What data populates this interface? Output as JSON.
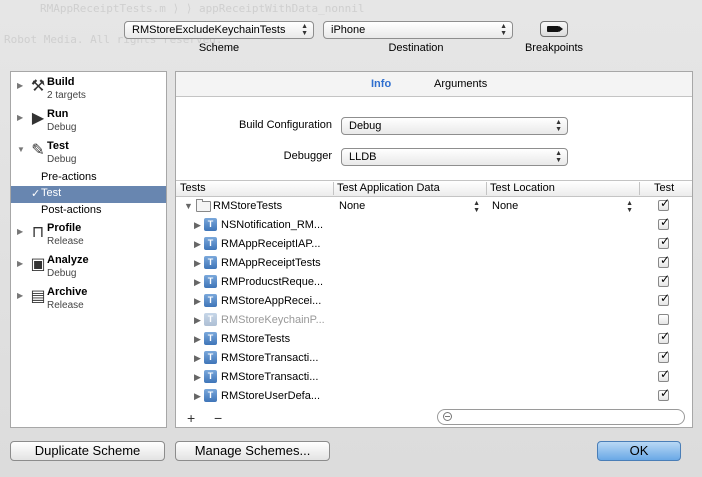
{
  "background": {
    "line1": "RMAppReceiptTests.m  ⟩  ⟩  appReceiptWithData_nonnil",
    "line2": "Robot Media. All rights reserved."
  },
  "toolbar": {
    "scheme_value": "RMStoreExcludeKeychainTests",
    "scheme_label": "Scheme",
    "destination_value": "iPhone",
    "destination_label": "Destination",
    "breakpoints_label": "Breakpoints"
  },
  "actions": [
    {
      "name": "Build",
      "subtitle": "2 targets",
      "icon": "hammer-icon",
      "glyph": "⚒"
    },
    {
      "name": "Run",
      "subtitle": "Debug",
      "icon": "play-icon",
      "glyph": "▶"
    },
    {
      "name": "Test",
      "subtitle": "Debug",
      "icon": "wrench-icon",
      "glyph": "🔧",
      "expanded": true,
      "subitems": [
        "Pre-actions",
        "Test",
        "Post-actions"
      ],
      "selected_subitem": "Test"
    },
    {
      "name": "Profile",
      "subtitle": "Release",
      "icon": "caliper-icon",
      "glyph": "⌖"
    },
    {
      "name": "Analyze",
      "subtitle": "Debug",
      "icon": "analyze-icon",
      "glyph": "▣"
    },
    {
      "name": "Archive",
      "subtitle": "Release",
      "icon": "archive-icon",
      "glyph": "▤"
    }
  ],
  "tabs": [
    "Info",
    "Arguments"
  ],
  "active_tab": "Info",
  "form": {
    "build_config_label": "Build Configuration",
    "build_config_value": "Debug",
    "debugger_label": "Debugger",
    "debugger_value": "LLDB"
  },
  "table": {
    "headers": [
      "Tests",
      "Test Application Data",
      "Test Location",
      "Test"
    ],
    "group": {
      "name": "RMStoreTests",
      "app_data": "None",
      "location": "None",
      "checked": true
    },
    "rows": [
      {
        "name": "NSNotification_RM...",
        "checked": true,
        "enabled": true
      },
      {
        "name": "RMAppReceiptIAP...",
        "checked": true,
        "enabled": true
      },
      {
        "name": "RMAppReceiptTests",
        "checked": true,
        "enabled": true
      },
      {
        "name": "RMProducstReque...",
        "checked": true,
        "enabled": true
      },
      {
        "name": "RMStoreAppRecei...",
        "checked": true,
        "enabled": true
      },
      {
        "name": "RMStoreKeychainP...",
        "checked": false,
        "enabled": false
      },
      {
        "name": "RMStoreTests",
        "checked": true,
        "enabled": true
      },
      {
        "name": "RMStoreTransacti...",
        "checked": true,
        "enabled": true
      },
      {
        "name": "RMStoreTransacti...",
        "checked": true,
        "enabled": true
      },
      {
        "name": "RMStoreUserDefa...",
        "checked": true,
        "enabled": true
      }
    ],
    "add_label": "+",
    "remove_label": "−",
    "filter_placeholder": ""
  },
  "buttons": {
    "duplicate": "Duplicate Scheme",
    "manage": "Manage Schemes...",
    "ok": "OK"
  }
}
